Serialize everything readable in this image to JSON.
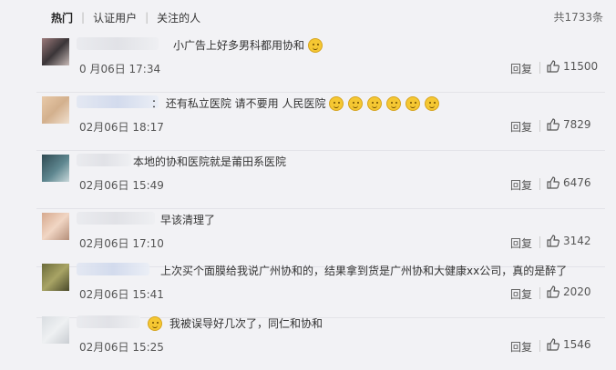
{
  "tabs": [
    "热门",
    "认证用户",
    "关注的人"
  ],
  "total_count": "共1733条",
  "comments": [
    {
      "text": "小广告上好多男科都用协和",
      "emoji_count": 1,
      "time": "0 月06日 17:34",
      "reply_label": "回复",
      "likes": "11500"
    },
    {
      "text": "： 还有私立医院 请不要用 人民医院",
      "emoji_count": 6,
      "time": "02月06日 18:17",
      "reply_label": "回复",
      "likes": "7829"
    },
    {
      "text": "本地的协和医院就是莆田系医院",
      "emoji_count": 0,
      "time": "02月06日 15:49",
      "reply_label": "回复",
      "likes": "6476"
    },
    {
      "text": "早该清理了",
      "emoji_count": 0,
      "time": "02月06日 17:10",
      "reply_label": "回复",
      "likes": "3142"
    },
    {
      "text": "上次买个面膜给我说广州协和的，结果拿到货是广州协和大健康xx公司，真的是醉了",
      "emoji_count": 0,
      "time": "02月06日 15:41",
      "reply_label": "回复",
      "likes": "2020"
    },
    {
      "text": "我被误导好几次了，同仁和协和",
      "emoji_count": 0,
      "time": "02月06日 15:25",
      "reply_label": "回复",
      "likes": "1546"
    }
  ],
  "colors": {
    "background": "#f2f2f5",
    "text": "#333333",
    "emoji": "#f5c732"
  },
  "icons": {
    "like": "thumbs-up-icon",
    "avatar": "blurred-avatar"
  }
}
